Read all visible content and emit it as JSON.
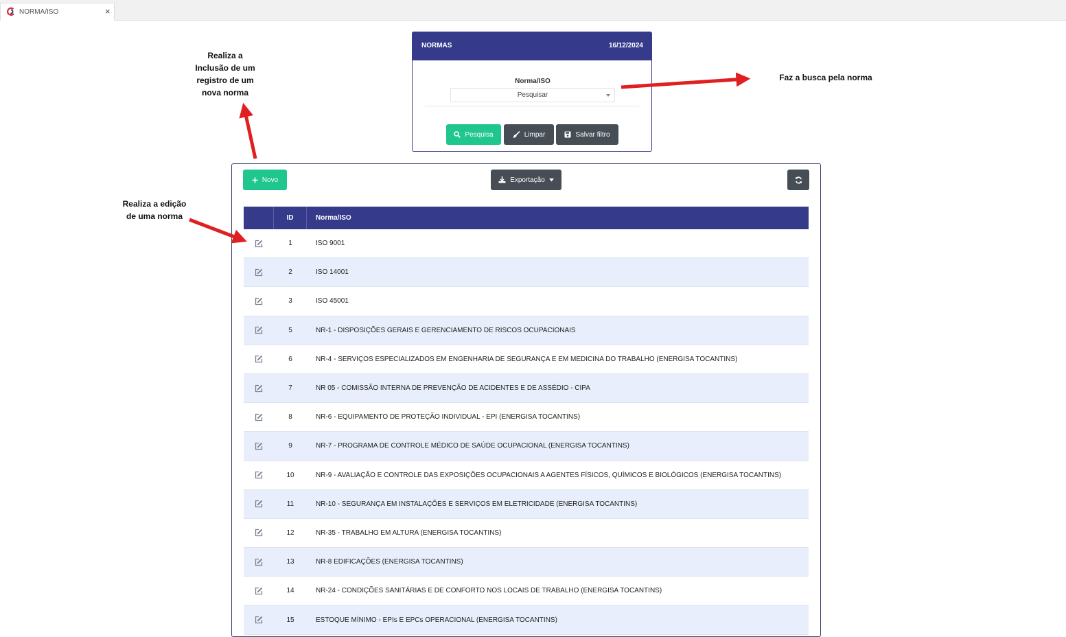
{
  "tab": {
    "title": "NORMA/ISO",
    "close": "×"
  },
  "filter": {
    "header_title": "NORMAS",
    "header_date": "16/12/2024",
    "field_label": "Norma/ISO",
    "select_value": "Pesquisar",
    "buttons": {
      "search": "Pesquisa",
      "clear": "Limpar",
      "save": "Salvar filtro"
    }
  },
  "toolbar": {
    "new": "Novo",
    "export": "Exportação"
  },
  "table": {
    "headers": [
      "ID",
      "Norma/ISO"
    ],
    "rows": [
      {
        "id": "1",
        "name": "ISO 9001"
      },
      {
        "id": "2",
        "name": "ISO 14001"
      },
      {
        "id": "3",
        "name": "ISO 45001"
      },
      {
        "id": "5",
        "name": "NR-1 - DISPOSIÇÕES GERAIS E GERENCIAMENTO DE RISCOS OCUPACIONAIS"
      },
      {
        "id": "6",
        "name": "NR-4 - SERVIÇOS ESPECIALIZADOS EM ENGENHARIA DE SEGURANÇA E EM MEDICINA DO TRABALHO (ENERGISA TOCANTINS)"
      },
      {
        "id": "7",
        "name": "NR 05 - COMISSÃO INTERNA DE PREVENÇÃO DE ACIDENTES E DE ASSÉDIO - CIPA"
      },
      {
        "id": "8",
        "name": "NR-6 - EQUIPAMENTO DE PROTEÇÃO INDIVIDUAL - EPI (ENERGISA TOCANTINS)"
      },
      {
        "id": "9",
        "name": "NR-7 - PROGRAMA DE CONTROLE MÉDICO DE SAÚDE OCUPACIONAL (ENERGISA TOCANTINS)"
      },
      {
        "id": "10",
        "name": "NR-9 - AVALIAÇÃO E CONTROLE DAS EXPOSIÇÕES OCUPACIONAIS A AGENTES FÍSICOS, QUÍMICOS E BIOLÓGICOS (ENERGISA TOCANTINS)"
      },
      {
        "id": "11",
        "name": "NR-10 - SEGURANÇA EM INSTALAÇÕES E SERVIÇOS EM ELETRICIDADE (ENERGISA TOCANTINS)"
      },
      {
        "id": "12",
        "name": "NR-35 - TRABALHO EM ALTURA (ENERGISA TOCANTINS)"
      },
      {
        "id": "13",
        "name": "NR-8 EDIFICAÇÕES (ENERGISA TOCANTINS)"
      },
      {
        "id": "14",
        "name": "NR-24 - CONDIÇÕES SANITÁRIAS E DE CONFORTO NOS LOCAIS DE TRABALHO (ENERGISA TOCANTINS)"
      },
      {
        "id": "15",
        "name": "ESTOQUE MÍNIMO - EPIs E EPCs OPERACIONAL (ENERGISA TOCANTINS)"
      }
    ]
  },
  "annotations": {
    "new_line1": "Realiza a",
    "new_line2": "Inclusão de um",
    "new_line3": "registro de um",
    "new_line4": "nova norma",
    "edit_line1": "Realiza a edição",
    "edit_line2": "de uma norma",
    "search": "Faz a busca pela norma"
  },
  "colors": {
    "primary": "#363a8a",
    "success": "#1fc68e",
    "dark": "#474d55",
    "row_alt": "#e8eefb",
    "arrow": "#e02020"
  },
  "icons": [
    "logo-icon",
    "close-icon",
    "search-icon",
    "brush-icon",
    "save-icon",
    "plus-icon",
    "download-icon",
    "caret-down-icon",
    "refresh-icon",
    "edit-icon"
  ]
}
